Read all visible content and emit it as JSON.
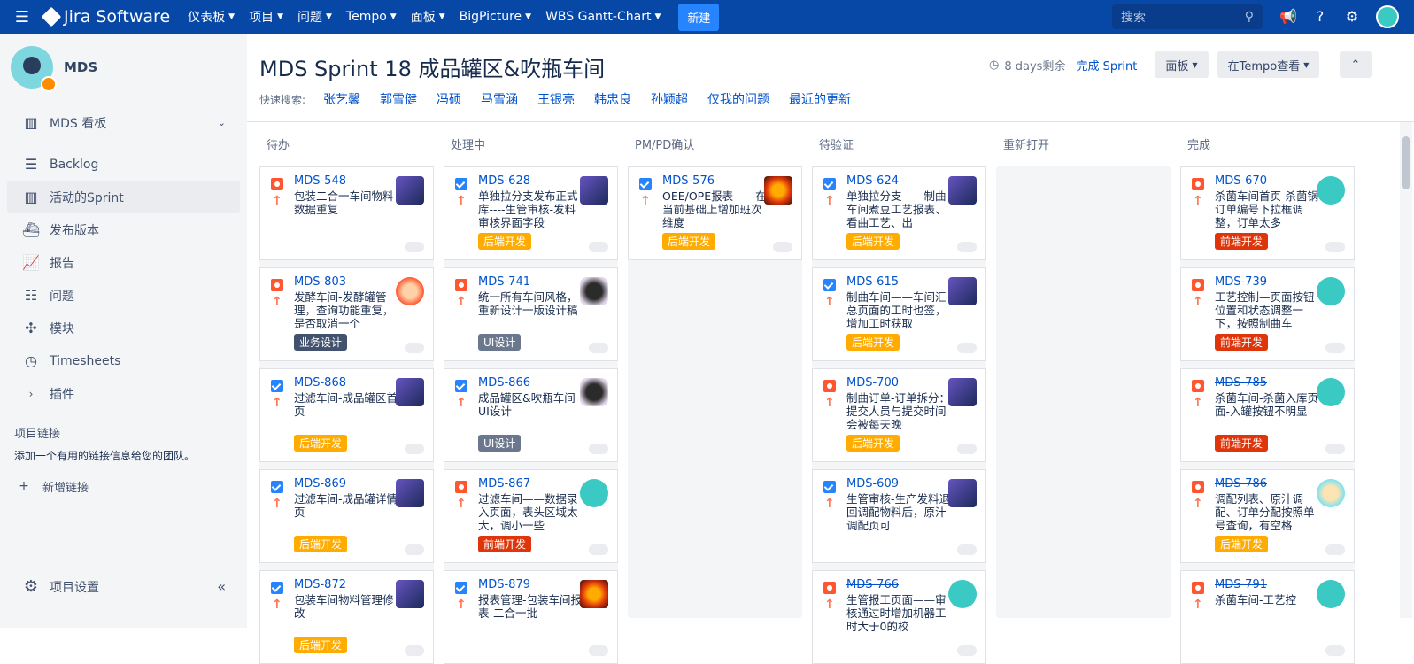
{
  "topnav": {
    "brand": "Jira Software",
    "menus": [
      "仪表板",
      "项目",
      "问题",
      "Tempo",
      "面板",
      "BigPicture",
      "WBS Gantt-Chart"
    ],
    "create": "新建",
    "search_placeholder": "搜索"
  },
  "sidebar": {
    "project_name": "MDS",
    "board_label": "MDS 看板",
    "items": [
      {
        "label": "Backlog",
        "icon": "backlog-icon"
      },
      {
        "label": "活动的Sprint",
        "icon": "sprint-board-icon",
        "active": true
      },
      {
        "label": "发布版本",
        "icon": "ship-icon"
      },
      {
        "label": "报告",
        "icon": "chart-icon"
      },
      {
        "label": "问题",
        "icon": "issues-icon"
      },
      {
        "label": "模块",
        "icon": "puzzle-icon"
      },
      {
        "label": "Timesheets",
        "icon": "clock-icon"
      },
      {
        "label": "插件",
        "icon": "chevron-right-icon"
      }
    ],
    "links_title": "项目链接",
    "links_desc": "添加一个有用的链接信息给您的团队。",
    "add_link": "新增链接",
    "settings": "项目设置"
  },
  "header": {
    "title": "MDS Sprint 18 成品罐区&吹瓶车间",
    "time_left": "8 days剩余",
    "complete_sprint": "完成 Sprint",
    "board_btn": "面板",
    "tempo_btn": "在Tempo查看",
    "quick_label": "快速搜索:",
    "quick_filters": [
      "张艺馨",
      "郭雪健",
      "冯硕",
      "马雪涵",
      "王银亮",
      "韩忠良",
      "孙颖超",
      "仅我的问题",
      "最近的更新"
    ]
  },
  "columns": [
    {
      "name": "待办",
      "cards": [
        {
          "key": "MDS-548",
          "type": "bug",
          "summary": "包装二合一车间物料数据重复",
          "label": "",
          "labelClass": "",
          "avatar": "a1"
        },
        {
          "key": "MDS-803",
          "type": "bug",
          "summary": "发酵车间-发酵罐管理，查询功能重复，是否取消一个",
          "label": "业务设计",
          "labelClass": "biz",
          "avatar": "a5"
        },
        {
          "key": "MDS-868",
          "type": "task",
          "summary": "过滤车间-成品罐区首页",
          "label": "后端开发",
          "labelClass": "dev",
          "avatar": "a1"
        },
        {
          "key": "MDS-869",
          "type": "task",
          "summary": "过滤车间-成品罐详情页",
          "label": "后端开发",
          "labelClass": "dev",
          "avatar": "a1"
        },
        {
          "key": "MDS-872",
          "type": "task",
          "summary": "包装车间物料管理修改",
          "label": "后端开发",
          "labelClass": "dev",
          "avatar": "a1"
        }
      ]
    },
    {
      "name": "处理中",
      "cards": [
        {
          "key": "MDS-628",
          "type": "task",
          "summary": "单独拉分支发布正式库----生管审核-发料审核界面字段",
          "label": "后端开发",
          "labelClass": "dev",
          "avatar": "a1"
        },
        {
          "key": "MDS-741",
          "type": "bug",
          "summary": "统一所有车间风格，重新设计一版设计稿",
          "label": "UI设计",
          "labelClass": "ui",
          "avatar": "a3"
        },
        {
          "key": "MDS-866",
          "type": "task",
          "summary": "成品罐区&吹瓶车间UI设计",
          "label": "UI设计",
          "labelClass": "ui",
          "avatar": "a3"
        },
        {
          "key": "MDS-867",
          "type": "bug",
          "summary": "过滤车间——数据录入页面，表头区域太大，调小一些",
          "label": "前端开发",
          "labelClass": "fe",
          "avatar": "a4"
        },
        {
          "key": "MDS-879",
          "type": "task",
          "summary": "报表管理-包装车间报表-二合一批",
          "label": "",
          "labelClass": "",
          "avatar": "a2"
        }
      ]
    },
    {
      "name": "PM/PD确认",
      "cards": [
        {
          "key": "MDS-576",
          "type": "task",
          "summary": "OEE/OPE报表——在当前基础上增加班次维度",
          "label": "后端开发",
          "labelClass": "dev",
          "avatar": "a2"
        }
      ]
    },
    {
      "name": "待验证",
      "cards": [
        {
          "key": "MDS-624",
          "type": "task",
          "summary": "单独拉分支——制曲车间煮豆工艺报表、看曲工艺、出",
          "label": "后端开发",
          "labelClass": "dev",
          "avatar": "a1"
        },
        {
          "key": "MDS-615",
          "type": "task",
          "summary": "制曲车间——车间汇总页面的工时也签，增加工时获取",
          "label": "后端开发",
          "labelClass": "dev",
          "avatar": "a1"
        },
        {
          "key": "MDS-700",
          "type": "bug",
          "summary": "制曲订单-订单拆分：提交人员与提交时间会被每天晚",
          "label": "后端开发",
          "labelClass": "dev",
          "avatar": "a1"
        },
        {
          "key": "MDS-609",
          "type": "task",
          "summary": "生管审核-生产发料退回调配物料后，原汁调配页可",
          "label": "",
          "labelClass": "",
          "avatar": "a1"
        },
        {
          "key": "MDS-766",
          "type": "bug",
          "summary": "生管报工页面——审核通过时增加机器工时大于0的校",
          "label": "",
          "labelClass": "",
          "avatar": "a4",
          "done": true
        }
      ]
    },
    {
      "name": "重新打开",
      "cards": []
    },
    {
      "name": "完成",
      "cards": [
        {
          "key": "MDS-670",
          "type": "bug",
          "summary": "杀菌车间首页-杀菌锅订单编号下拉框调整，订单太多",
          "label": "前端开发",
          "labelClass": "fe",
          "avatar": "a4",
          "done": true
        },
        {
          "key": "MDS-739",
          "type": "bug",
          "summary": "工艺控制—页面按钮位置和状态调整一下，按照制曲车",
          "label": "前端开发",
          "labelClass": "fe",
          "avatar": "a4",
          "done": true
        },
        {
          "key": "MDS-785",
          "type": "bug",
          "summary": "杀菌车间-杀菌入库页面-入罐按钮不明显",
          "label": "前端开发",
          "labelClass": "fe",
          "avatar": "a4",
          "done": true
        },
        {
          "key": "MDS-786",
          "type": "bug",
          "summary": "调配列表、原汁调配、订单分配按照单号查询，有空格",
          "label": "后端开发",
          "labelClass": "dev",
          "avatar": "a6",
          "done": true
        },
        {
          "key": "MDS-791",
          "type": "bug",
          "summary": "杀菌车间-工艺控",
          "label": "",
          "labelClass": "",
          "avatar": "a4",
          "done": true
        }
      ]
    }
  ]
}
